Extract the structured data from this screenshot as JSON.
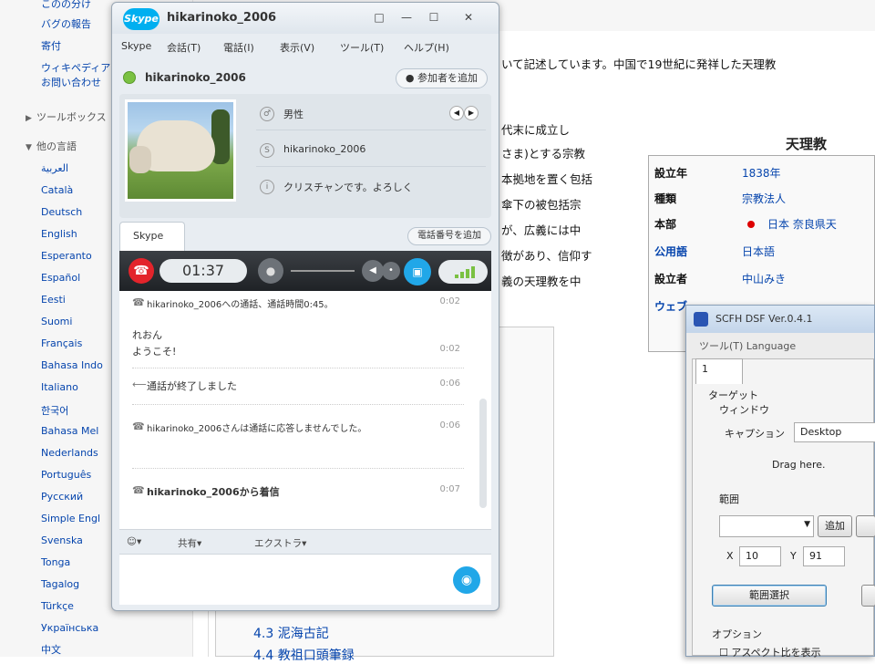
{
  "wiki": {
    "sidebar": {
      "top_links": [
        "このの分け",
        "バグの報告",
        "寄付",
        "ウィキペディアに",
        "お問い合わせ"
      ],
      "toolbox_label": "ツールボックス",
      "languages_label": "他の言語",
      "languages": [
        "العربية",
        "Català",
        "Deutsch",
        "English",
        "Esperanto",
        "Español",
        "Eesti",
        "Suomi",
        "Français",
        "Bahasa Indo",
        "Italiano",
        "한국어",
        "Bahasa Mel",
        "Nederlands",
        "Português",
        "Русский",
        "Simple Engl",
        "Svenska",
        "Tonga",
        "Tagalog",
        "Türkçe",
        "Українська",
        "中文"
      ]
    },
    "body_lines": [
      "いて記述しています。中国で19世紀に発祥した天理教",
      "代末に成立し",
      "さま)とする宗教",
      "本拠地を置く包括",
      "傘下の被包括宗",
      "が、広義には中",
      "徴があり、信仰す",
      "義の天理教を中"
    ],
    "infobox": {
      "title": "天理教",
      "rows": [
        {
          "key": "設立年",
          "value": "1838年",
          "key_link": false
        },
        {
          "key": "種類",
          "value": "宗教法人",
          "key_link": false
        },
        {
          "key": "本部",
          "value": "日本 奈良県天",
          "key_link": false
        },
        {
          "key": "公用語",
          "value": "日本語",
          "key_link": true
        },
        {
          "key": "設立者",
          "value": "中山みき",
          "key_link": false
        },
        {
          "key": "ウェブ",
          "value": "",
          "key_link": true
        }
      ]
    },
    "toc": [
      "4.3 泥海古記",
      "4.4 教祖口頭筆録"
    ]
  },
  "skype": {
    "window_title": "hikarinoko_2006",
    "logo": "Skype",
    "window_buttons": [
      "□",
      "—",
      "☐",
      "✕"
    ],
    "menu": [
      "Skype",
      "会話(T)",
      "電話(I)",
      "表示(V)",
      "ツール(T)",
      "ヘルプ(H)"
    ],
    "contact_name": "hikarinoko_2006",
    "add_participant": "● 参加者を追加",
    "profile_fields": [
      "男性",
      "hikarinoko_2006",
      "クリスチャンです。よろしく"
    ],
    "tab_label": "Skype",
    "phone_button": "電話番号を追加",
    "call_timer": "01:37",
    "messages": [
      {
        "icon": "☎",
        "text": "hikarinoko_2006への通話、通話時間0:45。",
        "time": "0:02",
        "bold": false
      },
      {
        "icon": "",
        "text": "れおん",
        "time": "",
        "bold": false
      },
      {
        "icon": "",
        "text": "ようこそ!",
        "time": "0:02",
        "bold": false
      },
      {
        "icon": "⟵",
        "text": "通話が終了しました",
        "time": "0:06",
        "bold": false
      },
      {
        "icon": "☎",
        "text": "hikarinoko_2006さんは通話に応答しませんでした。",
        "time": "0:06",
        "bold": false
      },
      {
        "icon": "☎",
        "text": "hikarinoko_2006から着信",
        "time": "0:07",
        "bold": true
      }
    ],
    "toolbar": [
      "☺▾",
      "共有▾",
      "エクストラ▾"
    ]
  },
  "scfh": {
    "title": "SCFH DSF Ver.0.4.1",
    "menu": "ツール(T)  Language",
    "tab": "1",
    "target_label": "ターゲット",
    "window_label": "ウィンドウ",
    "caption_label": "キャプション",
    "caption_value": "Desktop",
    "drag_label": "Drag here.",
    "range_label": "範囲",
    "add_button": "追加",
    "x_label": "X",
    "x_value": "10",
    "y_label": "Y",
    "y_value": "91",
    "select_range_button": "範囲選択",
    "options_label": "オプション",
    "aspect_label": "アスペクト比を表示"
  }
}
